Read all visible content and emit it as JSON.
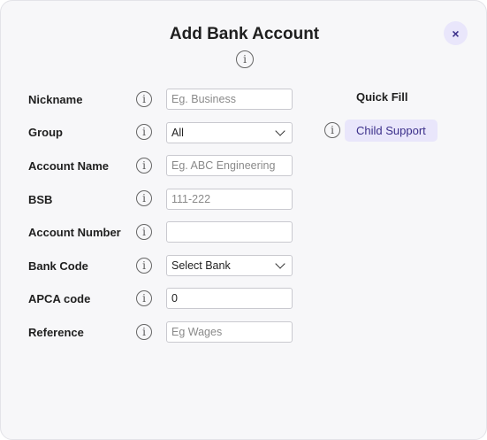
{
  "dialog": {
    "title": "Add Bank Account",
    "close_label": "×"
  },
  "icons": {
    "info_glyph": "i"
  },
  "form": {
    "nickname": {
      "label": "Nickname",
      "placeholder": "Eg. Business",
      "value": ""
    },
    "group": {
      "label": "Group",
      "selected": "All"
    },
    "account_name": {
      "label": "Account Name",
      "placeholder": "Eg. ABC Engineering",
      "value": ""
    },
    "bsb": {
      "label": "BSB",
      "placeholder": "111-222",
      "value": ""
    },
    "account_number": {
      "label": "Account Number",
      "placeholder": "",
      "value": ""
    },
    "bank_code": {
      "label": "Bank Code",
      "selected": "Select Bank"
    },
    "apca_code": {
      "label": "APCA code",
      "placeholder": "",
      "value": "0"
    },
    "reference": {
      "label": "Reference",
      "placeholder": "Eg Wages",
      "value": ""
    }
  },
  "quick_fill": {
    "title": "Quick Fill",
    "items": [
      {
        "label": "Child Support"
      }
    ]
  },
  "colors": {
    "accent_bg": "#e9e6fb",
    "accent_text": "#3b2f8a"
  }
}
